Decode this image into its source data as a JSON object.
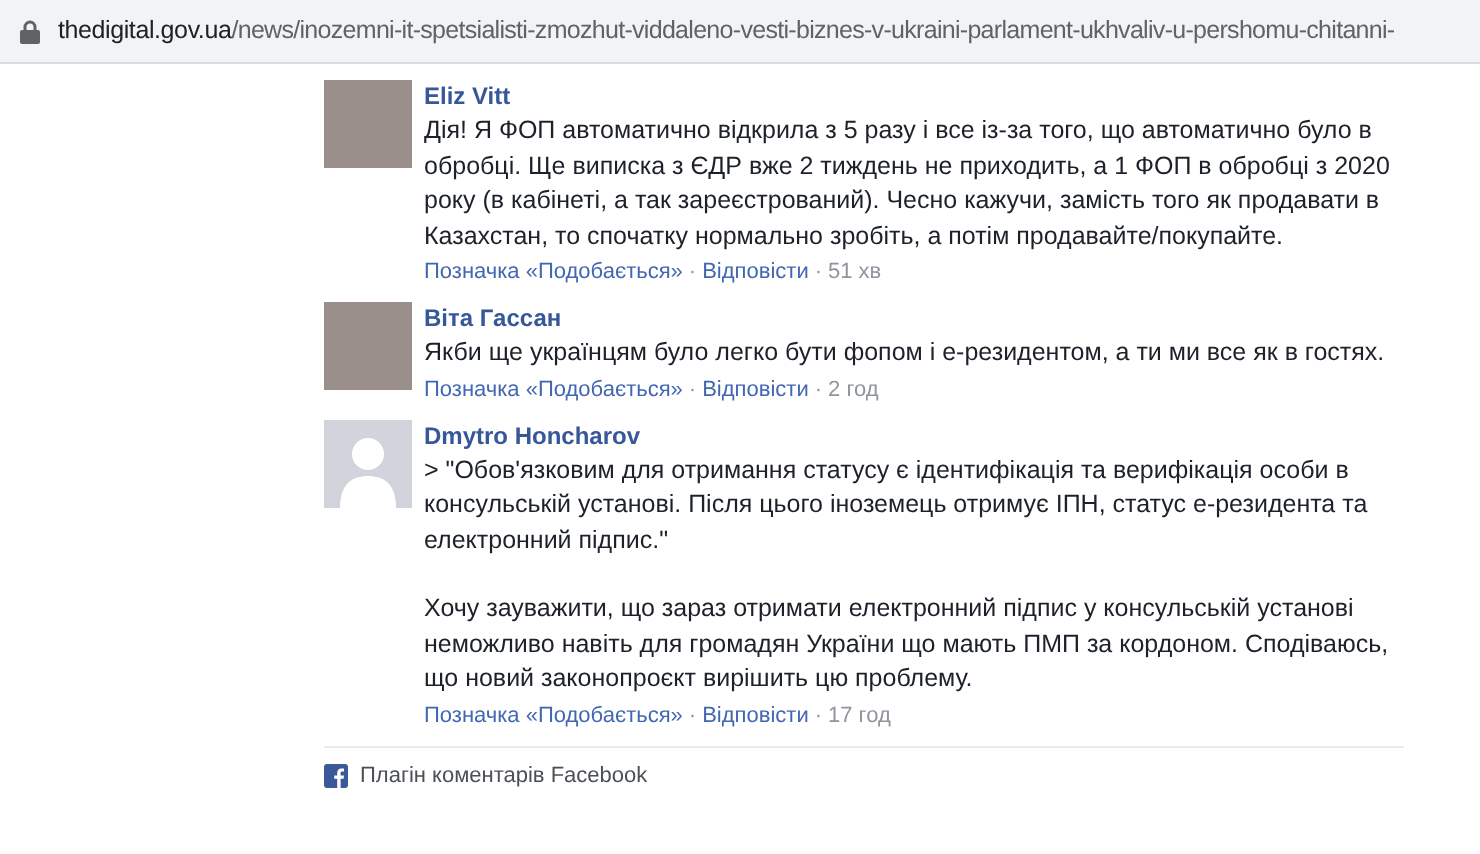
{
  "address_bar": {
    "domain": "thedigital.gov.ua",
    "path": "/news/inozemni-it-spetsialisti-zmozhut-viddaleno-vesti-biznes-v-ukraini-parlament-ukhvaliv-u-pershomu-chitanni-"
  },
  "comments": [
    {
      "author": "Eliz Vitt",
      "kind": "photo",
      "paragraphs": [
        "Дія! Я ФОП автоматично відкрила з 5 разу і все із-за того, що автоматично було в обробці. Ще виписка з ЄДР вже 2 тиждень не приходить, а 1 ФОП в обробці з 2020 року (в кабінеті, а так зареєстрований). Чесно кажучи, замість того як продавати в Казахстан, то спочатку нормально зробіть, а потім продавайте/покупайте."
      ],
      "like": "Позначка «Подобається»",
      "separator_1": "·",
      "reply": "Відповісти",
      "separator_2": "·",
      "time": "51 хв"
    },
    {
      "author": "Віта Гассан",
      "kind": "photo",
      "paragraphs": [
        "Якби ще українцям було легко бути фопом і е-резидентом, а ти ми все як в гостях."
      ],
      "like": "Позначка «Подобається»",
      "separator_1": "·",
      "reply": "Відповісти",
      "separator_2": "·",
      "time": "2 год"
    },
    {
      "author": "Dmytro Honcharov",
      "kind": "default",
      "paragraphs": [
        "> \"Обов'язковим для отримання статусу є ідентифікація та верифікація особи в консульській установі. Після цього іноземець отримує ІПН, статус е-резидента та електронний підпис.\"",
        "Хочу зауважити, що зараз отримати електронний підпис у консульській установі неможливо навіть для громадян України що мають ПМП за кордоном. Сподіваюсь, що новий законопроєкт вирішить цю проблему."
      ],
      "like": "Позначка «Подобається»",
      "separator_1": "·",
      "reply": "Відповісти",
      "separator_2": "·",
      "time": "17 год"
    }
  ],
  "plugin_footer": "Плагін коментарів Facebook"
}
